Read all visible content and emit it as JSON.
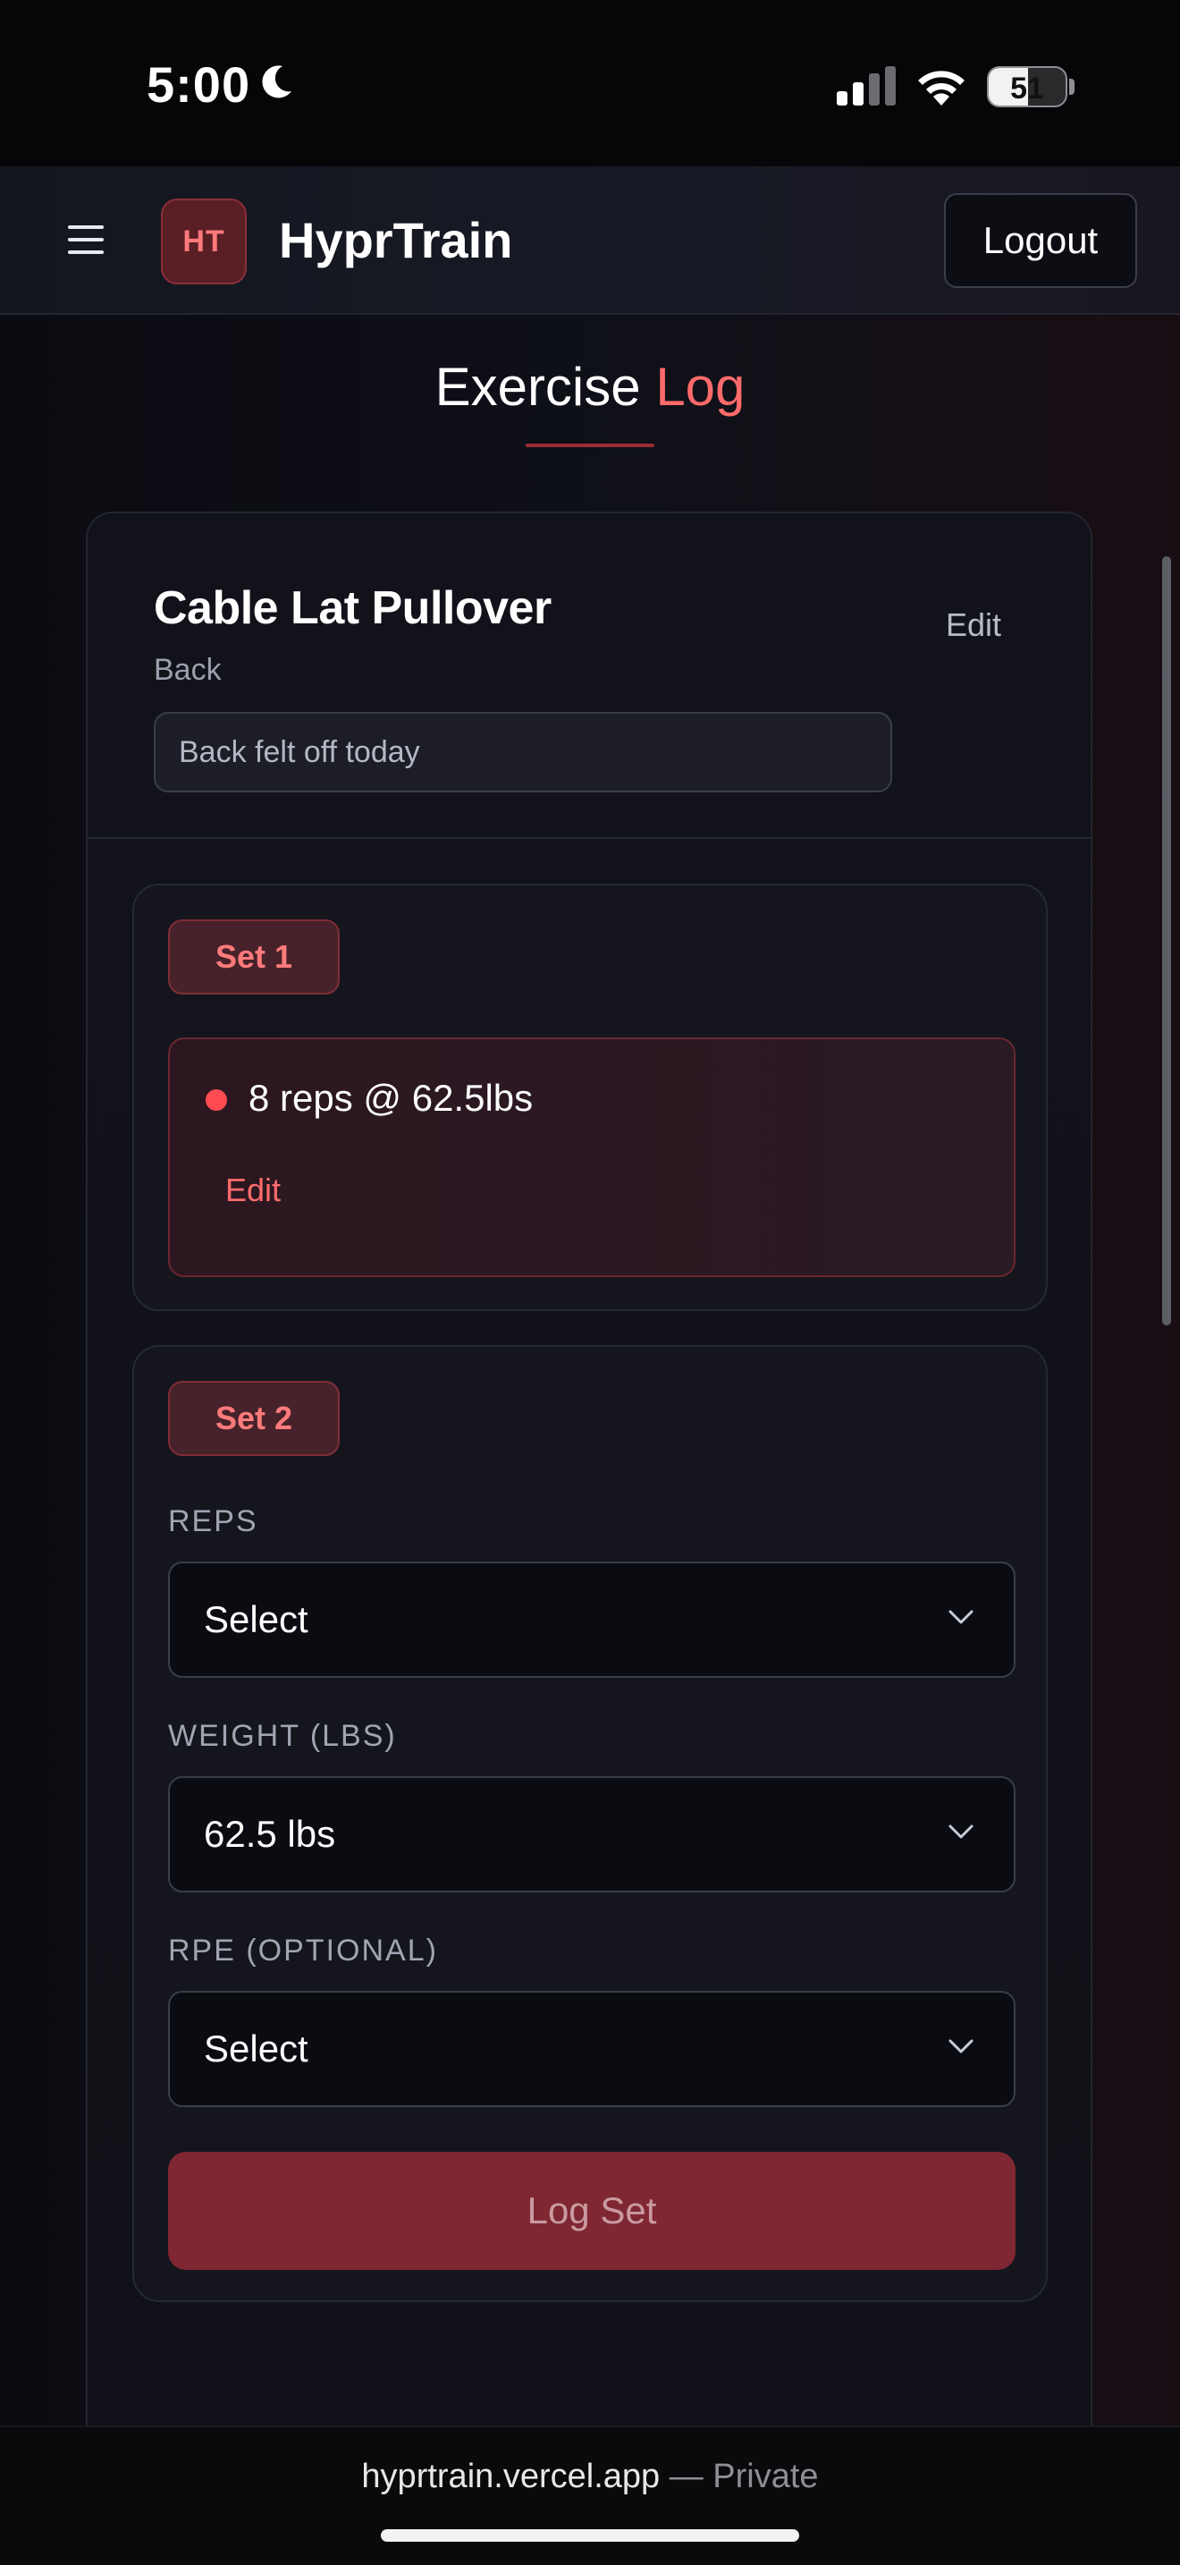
{
  "status_bar": {
    "time": "5:00",
    "battery": "51",
    "battery_level": 0.51,
    "icons": [
      "moon-icon",
      "cellular-signal-icon",
      "wifi-icon",
      "battery-icon"
    ]
  },
  "header": {
    "menu_icon": "hamburger-menu-icon",
    "logo_text": "HT",
    "brand": "HyprTrain",
    "logout_label": "Logout"
  },
  "page": {
    "title_main": "Exercise",
    "title_accent": "Log"
  },
  "exercise": {
    "name": "Cable Lat Pullover",
    "muscle_group": "Back",
    "edit_label": "Edit",
    "note_value": "Back felt off today"
  },
  "sets": [
    {
      "label": "Set 1",
      "logged_text": "8 reps @ 62.5lbs",
      "edit_label": "Edit"
    },
    {
      "label": "Set 2",
      "reps_label": "REPS",
      "reps_value": "Select",
      "weight_label": "WEIGHT (LBS)",
      "weight_value": "62.5 lbs",
      "rpe_label": "RPE (OPTIONAL)",
      "rpe_value": "Select",
      "log_button_label": "Log Set"
    }
  ],
  "browser": {
    "domain": "hyprtrain.vercel.app",
    "separator": "—",
    "mode": "Private"
  },
  "colors": {
    "accent": "#ff6b6b",
    "badge_bg": "#47222a",
    "button_bg": "#7f2732",
    "background": "#0b0c12"
  }
}
